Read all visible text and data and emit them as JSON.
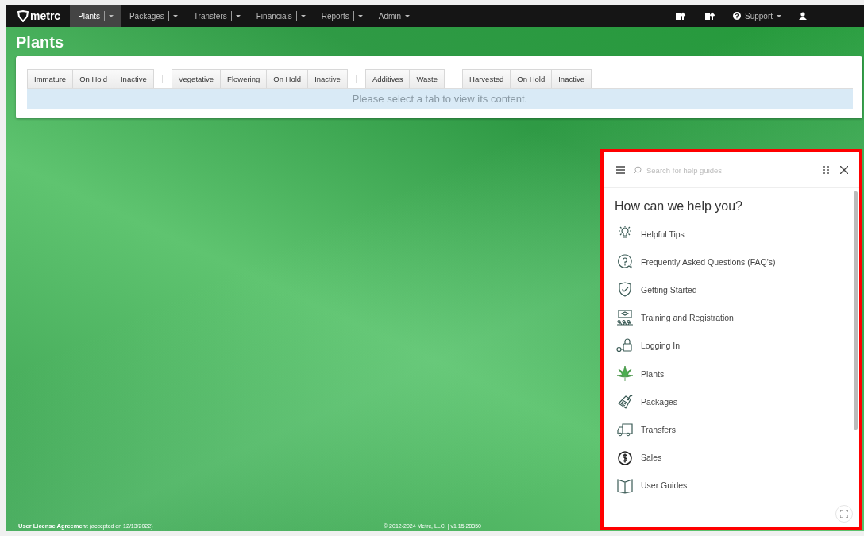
{
  "navbar": {
    "brand": "metrc",
    "menus": [
      {
        "label": "Plants",
        "kind": "split",
        "selected": true
      },
      {
        "label": "Packages",
        "kind": "split",
        "selected": false
      },
      {
        "label": "Transfers",
        "kind": "split",
        "selected": false
      },
      {
        "label": "Financials",
        "kind": "split",
        "selected": false
      },
      {
        "label": "Reports",
        "kind": "split",
        "selected": false
      },
      {
        "label": "Admin",
        "kind": "dropdown",
        "selected": false
      }
    ],
    "support": "Support"
  },
  "page_title": "Plants",
  "tab_groups": [
    {
      "tabs": [
        {
          "label": "Immature",
          "selected": false
        },
        {
          "label": "On Hold",
          "selected": false
        },
        {
          "label": "Inactive",
          "selected": false
        }
      ]
    },
    {
      "tabs": [
        {
          "label": "Vegetative",
          "selected": false
        },
        {
          "label": "Flowering",
          "selected": false
        },
        {
          "label": "On Hold",
          "selected": false
        },
        {
          "label": "Inactive",
          "selected": false
        }
      ]
    },
    {
      "tabs": [
        {
          "label": "Additives",
          "selected": false
        },
        {
          "label": "Waste",
          "selected": false
        }
      ]
    },
    {
      "tabs": [
        {
          "label": "Harvested",
          "selected": false
        },
        {
          "label": "On Hold",
          "selected": false
        },
        {
          "label": "Inactive",
          "selected": false
        }
      ]
    }
  ],
  "tab_message": "Please select a tab to view its content.",
  "help_widget": {
    "search": {
      "placeholder": "Search for help guides"
    },
    "heading": "How can we help you?",
    "items": [
      {
        "label": "Helpful Tips",
        "kind": "bulb"
      },
      {
        "label": "Frequently Asked Questions (FAQ's)",
        "kind": "question"
      },
      {
        "label": "Getting Started",
        "kind": "shield"
      },
      {
        "label": "Training and Registration",
        "kind": "training"
      },
      {
        "label": "Logging In",
        "kind": "lock"
      },
      {
        "label": "Plants",
        "kind": "leaf"
      },
      {
        "label": "Packages",
        "kind": "tag"
      },
      {
        "label": "Transfers",
        "kind": "truck"
      },
      {
        "label": "Sales",
        "kind": "dollar"
      },
      {
        "label": "User Guides",
        "kind": "book"
      }
    ]
  },
  "footer": {
    "license": "User License Agreement",
    "accepted": "(accepted on 12/13/2022)",
    "copyright": "© 2012-2024 Metrc, LLC. | v1.15.28350"
  }
}
